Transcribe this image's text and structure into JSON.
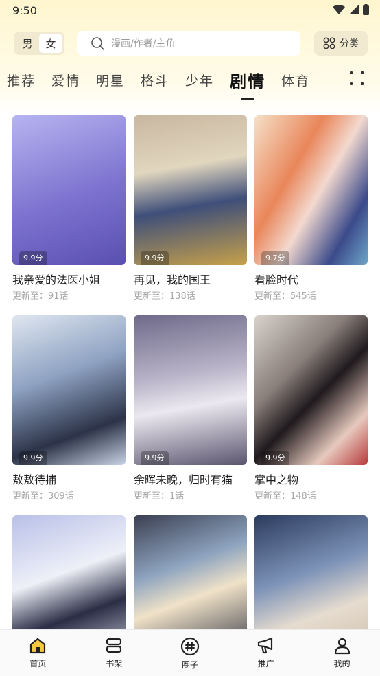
{
  "status_bar": {
    "time": "9:50"
  },
  "header": {
    "gender_toggle": [
      "男",
      "女"
    ],
    "search_placeholder": "漫画/作者/主角",
    "category_label": "分类"
  },
  "tabs": [
    "推荐",
    "爱情",
    "明星",
    "格斗",
    "少年",
    "剧情",
    "体育"
  ],
  "active_tab": "剧情",
  "comics": [
    {
      "title": "我亲爱的法医小姐",
      "score": "9.9分",
      "update": "更新至：91话"
    },
    {
      "title": "再见，我的国王",
      "score": "9.9分",
      "update": "更新至：138话"
    },
    {
      "title": "看脸时代",
      "score": "9.7分",
      "update": "更新至：545话"
    },
    {
      "title": "敖敖待捕",
      "score": "9.9分",
      "update": "更新至：309话"
    },
    {
      "title": "余晖未晚，归时有猫",
      "score": "9.9分",
      "update": "更新至：1话"
    },
    {
      "title": "掌中之物",
      "score": "9.9分",
      "update": "更新至：148话"
    },
    {
      "title": "",
      "score": "",
      "update": ""
    },
    {
      "title": "",
      "score": "",
      "update": ""
    },
    {
      "title": "",
      "score": "",
      "update": ""
    }
  ],
  "bottom_nav": [
    "首页",
    "书架",
    "圈子",
    "推广",
    "我的"
  ],
  "colors": {
    "accent": "#f5c842",
    "header_bg": "#fff6cf",
    "chip_bg": "#f1ead0"
  }
}
